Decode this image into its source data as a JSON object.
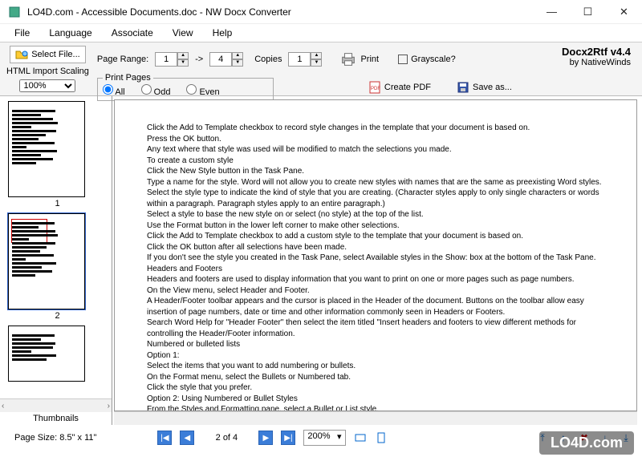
{
  "window": {
    "title": "LO4D.com - Accessible Documents.doc - NW Docx Converter"
  },
  "menu": {
    "file": "File",
    "language": "Language",
    "associate": "Associate",
    "view": "View",
    "help": "Help"
  },
  "toolbar": {
    "select_file": "Select File...",
    "html_scaling_label": "HTML Import Scaling",
    "scaling_value": "100%",
    "page_range_label": "Page Range:",
    "page_from": "1",
    "page_to": "4",
    "arrow": "->",
    "copies_label": "Copies",
    "copies_value": "1",
    "print": "Print",
    "grayscale": "Grayscale?",
    "print_pages_legend": "Print Pages",
    "radio_all": "All",
    "radio_odd": "Odd",
    "radio_even": "Even",
    "create_pdf": "Create PDF",
    "save_as": "Save as..."
  },
  "brand": {
    "title": "Docx2Rtf v4.4",
    "by": "by NativeWinds"
  },
  "thumbs": {
    "label": "Thumbnails",
    "p1": "1",
    "p2": "2"
  },
  "pagesize": {
    "label": "Page Size:",
    "value": "8.5\" x 11\""
  },
  "nav": {
    "pos": "2 of 4",
    "zoom": "200%"
  },
  "doc": {
    "l01": "Click the Add to Template checkbox to record style changes in the template that your document is based on.",
    "l02": "Press the OK button.",
    "l03": "Any text where that style was used will be modified to match the selections you made.",
    "l04": "To create a custom style",
    "l05": "Click the New Style button in the Task Pane.",
    "l06": "Type a name for the style. Word will not allow you to create new styles with names that are the same as preexisting Word styles.",
    "l07": "Select the style type to indicate the kind of style that you are creating. (Character styles apply to only single characters or words within a paragraph. Paragraph styles apply to an entire paragraph.)",
    "l08": "Select a style to base the new style on or select (no style) at the top of the list.",
    "l09": "Use the Format button in the lower left corner to make other selections.",
    "l10": "Click the Add to Template checkbox to add a custom style to the template that your document is based on.",
    "l11": "Click the OK button after all selections have been made.",
    "l12": "If you don't see the style you created in the Task Pane, select Available styles in the Show: box at the bottom of the Task Pane.",
    "l13": "Headers and Footers",
    "l14": "Headers and footers are used to display information that you want to print on one or more pages such as page numbers.",
    "l15": "On the View menu, select Header and Footer.",
    "l16": "A Header/Footer toolbar appears and the cursor is placed in the Header of the document. Buttons on the toolbar allow easy insertion of page numbers, date or time and other information commonly seen in Headers or Footers.",
    "l17": "Search Word Help for \"Header Footer\" then select the item titled \"Insert headers and footers to view different methods for controlling the Header/Footer information.",
    "l18": "Numbered or bulleted lists",
    "l19": "Option 1:",
    "l20": "Select the items that you want to add numbering or bullets.",
    "l21": "On the Format menu, select the Bullets or Numbered tab.",
    "l22": "Click the style that you prefer.",
    "l23": "Option 2: Using Numbered or Bullet Styles",
    "l24": "From the Styles and Formatting pane, select a Bullet or List style."
  },
  "watermark": "LO4D.com"
}
